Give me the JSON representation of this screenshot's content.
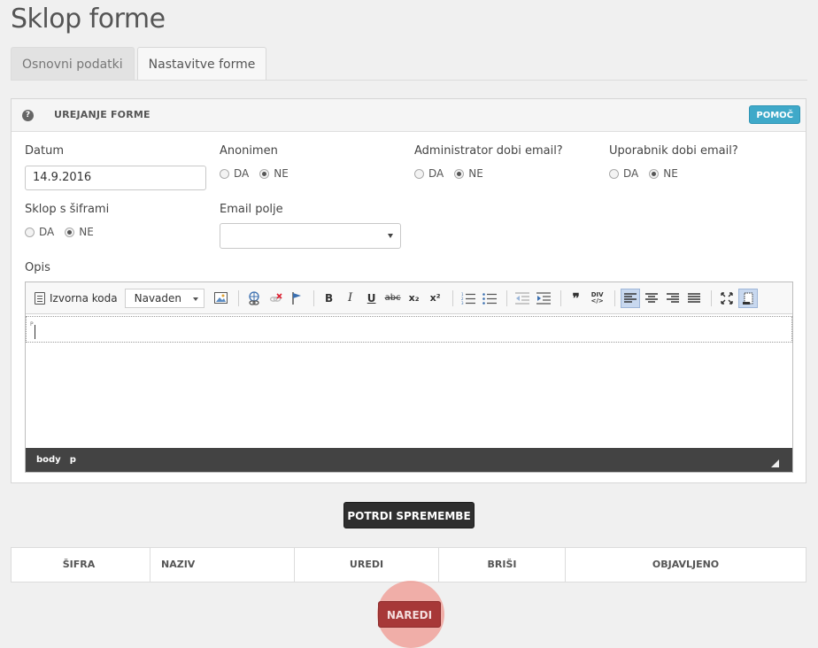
{
  "page": {
    "title": "Sklop forme"
  },
  "tabs": [
    {
      "label": "Osnovni podatki",
      "active": false
    },
    {
      "label": "Nastavitve forme",
      "active": true
    }
  ],
  "panel": {
    "title": "UREJANJE FORME",
    "help_icon": "?",
    "help_button": "POMOČ"
  },
  "fields": {
    "datum": {
      "label": "Datum",
      "value": "14.9.2016"
    },
    "anonimen": {
      "label": "Anonimen",
      "options": [
        "DA",
        "NE"
      ],
      "selected": "NE"
    },
    "admin_email": {
      "label": "Administrator dobi email?",
      "options": [
        "DA",
        "NE"
      ],
      "selected": "NE"
    },
    "user_email": {
      "label": "Uporabnik dobi email?",
      "options": [
        "DA",
        "NE"
      ],
      "selected": "NE"
    },
    "sklop_siframi": {
      "label": "Sklop s šiframi",
      "options": [
        "DA",
        "NE"
      ],
      "selected": "NE"
    },
    "email_polje": {
      "label": "Email polje",
      "value": ""
    },
    "opis": {
      "label": "Opis"
    }
  },
  "editor": {
    "source_label": "Izvorna koda",
    "format_value": "Navaden",
    "buttons": {
      "bold": "B",
      "italic": "I",
      "underline": "U",
      "strike": "abc",
      "subscript": "x₂",
      "superscript": "x²",
      "blockquote": "❞",
      "div": "DIV"
    },
    "path": [
      "body",
      "p"
    ],
    "block_marker": "P"
  },
  "actions": {
    "confirm": "POTRDI SPREMEMBE",
    "create": "NAREDI"
  },
  "table": {
    "columns": [
      "ŠIFRA",
      "NAZIV",
      "UREDI",
      "BRIŠI",
      "OBJAVLJENO"
    ]
  },
  "colors": {
    "help": "#3fa9c9",
    "confirm": "#2f2f2f",
    "create": "#a73838",
    "highlight": "#f0786e"
  }
}
